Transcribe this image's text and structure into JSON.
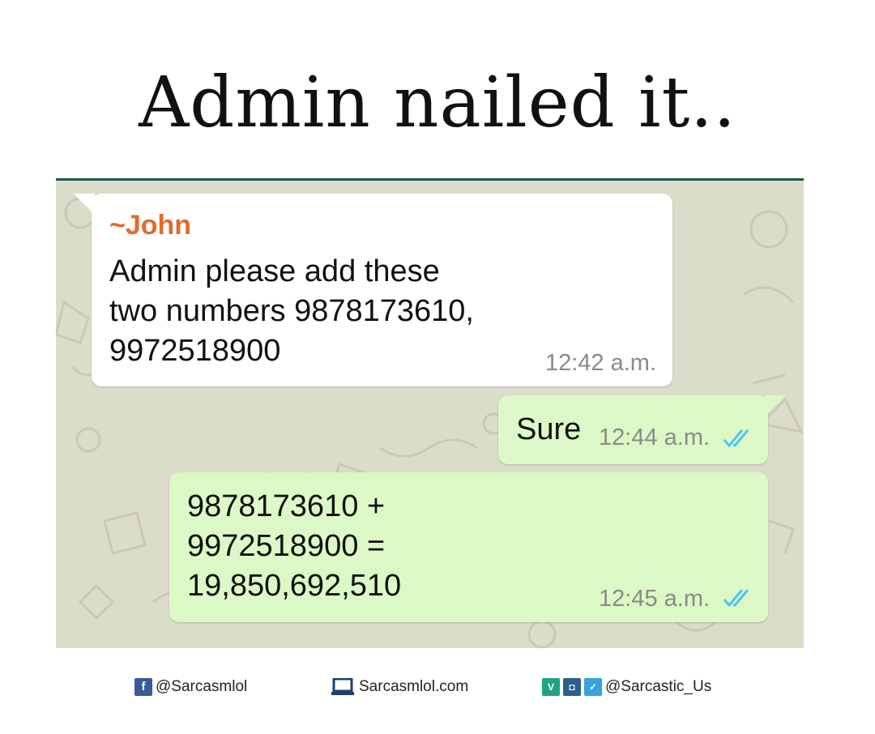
{
  "title": "Admin nailed it..",
  "chat": {
    "messages": [
      {
        "direction": "incoming",
        "sender": "~John",
        "lines": [
          "Admin please add these",
          "two numbers 9878173610,",
          "9972518900"
        ],
        "time": "12:42 a.m."
      },
      {
        "direction": "outgoing",
        "lines": [
          "Sure"
        ],
        "time": "12:44 a.m.",
        "status": "read"
      },
      {
        "direction": "outgoing",
        "lines": [
          "9878173610 +",
          "9972518900 =",
          "19,850,692,510"
        ],
        "time": "12:45 a.m.",
        "status": "read"
      }
    ]
  },
  "footer": {
    "facebook_handle": "@Sarcasmlol",
    "website": "Sarcasmlol.com",
    "social_handle": "@Sarcastic_Us"
  },
  "colors": {
    "sender_name": "#e26a2c",
    "read_tick": "#4fc3f7",
    "incoming_bubble": "#ffffff",
    "outgoing_bubble": "#dcf8c6",
    "chat_wallpaper": "#dcdccb"
  },
  "icons": [
    "facebook-icon",
    "laptop-icon",
    "vine-icon",
    "instagram-icon",
    "twitter-icon",
    "double-check-icon"
  ]
}
